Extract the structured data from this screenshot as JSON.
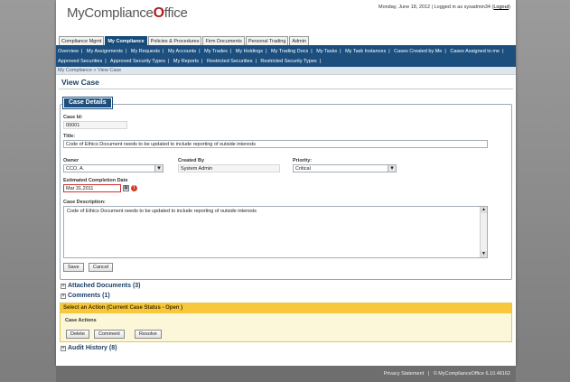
{
  "app": {
    "logo_prefix": "MyCompliance",
    "logo_o": "O",
    "logo_suffix": "ffice",
    "date": "Monday, June 18, 2012",
    "logged_in_text": "Logged in as sysadmin34",
    "logout_label": "Logout"
  },
  "topnav": [
    {
      "label": "Compliance Mgmt",
      "active": false
    },
    {
      "label": "My Compliance",
      "active": true
    },
    {
      "label": "Policies & Procedures",
      "active": false
    },
    {
      "label": "Firm Documents",
      "active": false
    },
    {
      "label": "Personal Trading",
      "active": false
    },
    {
      "label": "Admin",
      "active": false
    }
  ],
  "subnav_row1": [
    "Overview",
    "My Assignments",
    "My Requests",
    "My Accounts",
    "My Trades",
    "My Holdings",
    "My Trading Docs",
    "My Tasks",
    "My Task Instances",
    "Cases Created by Me",
    "Cases Assigned to me"
  ],
  "subnav_row2": [
    "Approved Securities",
    "Approved Security Types",
    "My Reports",
    "Restricted Securities",
    "Restricted Security Types"
  ],
  "breadcrumb": "My Compliance » View Case",
  "page_title": "View Case",
  "case_details": {
    "legend": "Case Details",
    "case_id_label": "Case Id:",
    "case_id": "00001",
    "title_label": "Title:",
    "title": "Code of Ethics Document needs to be updated to include reporting of outside interests",
    "owner_label": "Owner",
    "owner": "CCO, A.",
    "created_by_label": "Created By",
    "created_by": "System Admin",
    "priority_label": "Priority:",
    "priority": "Critical",
    "est_date_label": "Estimated Completion Date",
    "est_date": "Mar 31,2011",
    "description_label": "Case Description:",
    "description": "Code of Ethics Document needs to be updated to include reporting of outside interests",
    "save_label": "Save",
    "cancel_label": "Cancel"
  },
  "sections": {
    "attached": "Attached Documents (3)",
    "comments": "Comments (1)",
    "audit": "Audit History (8)"
  },
  "actions": {
    "header": "Select an Action (Current Case Status - Open )",
    "subheading": "Case Actions",
    "delete_label": "Delete",
    "comment_label": "Comment",
    "resolve_label": "Resolve"
  },
  "footer": {
    "privacy": "Privacy Statement",
    "separator": "|",
    "copyright": "© MyComplianceOffice 6.10.48162"
  }
}
